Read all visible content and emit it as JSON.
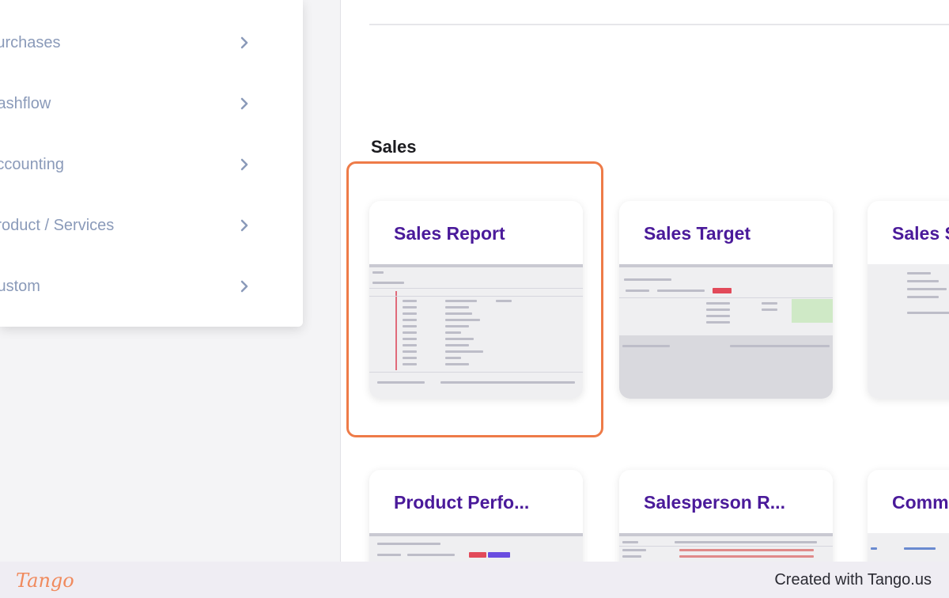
{
  "sidebar": {
    "items": [
      {
        "label": "Purchases",
        "icon": "chevron-right-icon"
      },
      {
        "label": "Cashflow",
        "icon": "chevron-right-icon"
      },
      {
        "label": "Accounting",
        "icon": "chevron-right-icon"
      },
      {
        "label": "Product / Services",
        "icon": "chevron-right-icon"
      },
      {
        "label": "Custom",
        "icon": "chevron-right-icon"
      }
    ]
  },
  "main": {
    "section_title": "Sales",
    "cards": [
      {
        "title": "Sales Report"
      },
      {
        "title": "Sales Target"
      },
      {
        "title": "Sales S"
      },
      {
        "title": "Product Perfo..."
      },
      {
        "title": "Salesperson R..."
      },
      {
        "title": "Commi"
      }
    ]
  },
  "footer": {
    "brand": "Tango",
    "credit": "Created with Tango.us"
  },
  "colors": {
    "highlight": "#ee7b48",
    "card_title": "#4a1a9a",
    "menu_text": "#8a9ab9",
    "brand": "#f08a5d"
  }
}
